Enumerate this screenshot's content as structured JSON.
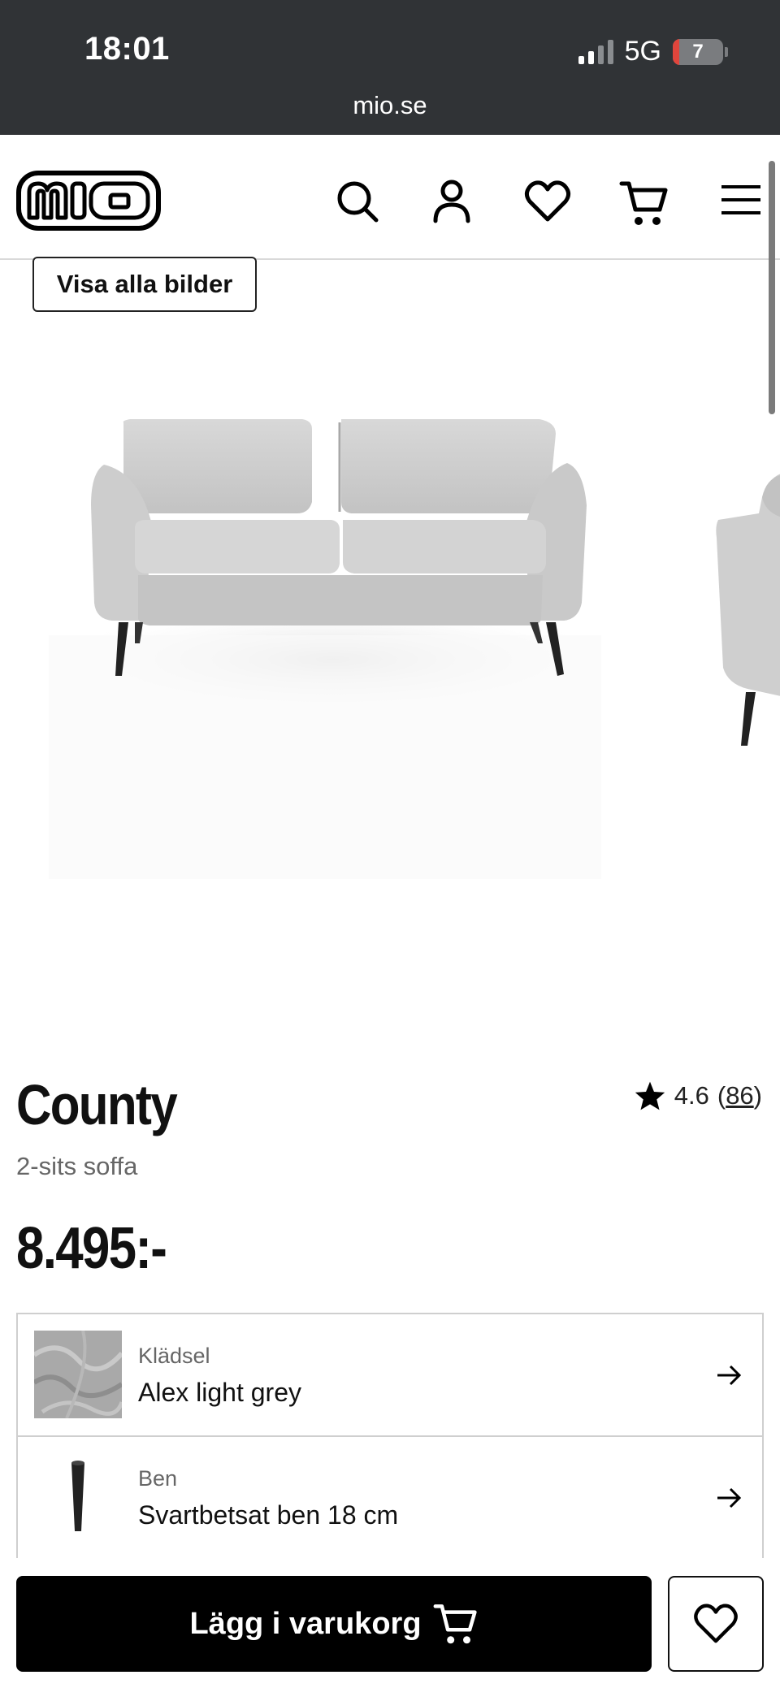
{
  "status_bar": {
    "time": "18:01",
    "network": "5G",
    "battery": "7",
    "battery_color": "#e0453c",
    "url": "mio.se"
  },
  "header": {
    "logo": "mio",
    "icons": [
      "search-icon",
      "account-icon",
      "heart-icon",
      "cart-icon",
      "menu-icon"
    ]
  },
  "gallery": {
    "show_all_label": "Visa alla bilder"
  },
  "product": {
    "title": "County",
    "subtitle": "2-sits soffa",
    "price": "8.495:-",
    "rating": "4.6",
    "rating_count": "(86)",
    "rating_count_open": "(",
    "rating_count_value": "86",
    "rating_count_close": ")"
  },
  "options": [
    {
      "label": "Klädsel",
      "value": "Alex light grey"
    },
    {
      "label": "Ben",
      "value": "Svartbetsat ben 18 cm"
    }
  ],
  "actions": {
    "add_to_cart_label": "Lägg i varukorg"
  },
  "colors": {
    "status_bar_bg": "#303336",
    "accent": "#000000",
    "border": "#cfcfcf"
  }
}
